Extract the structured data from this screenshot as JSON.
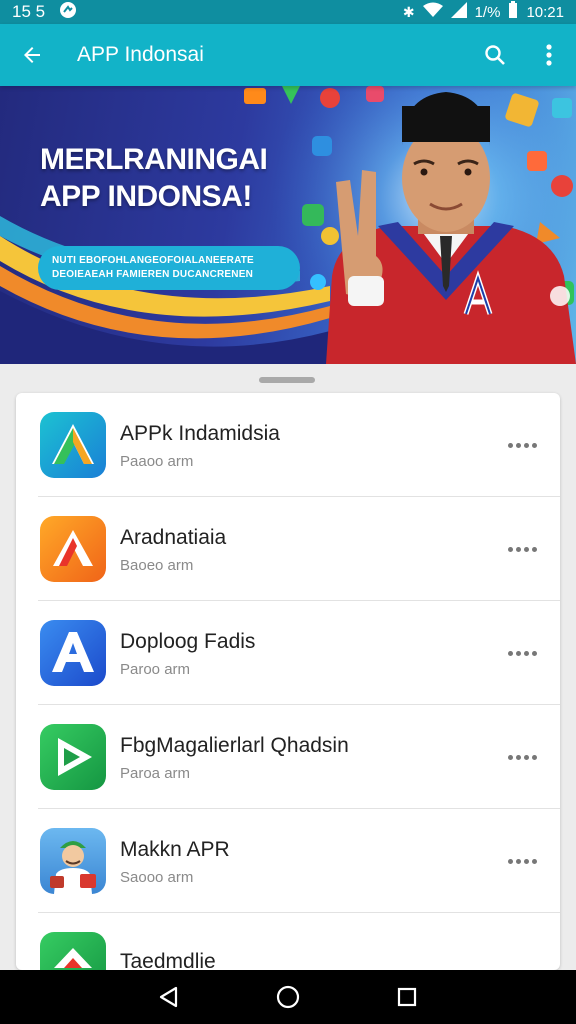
{
  "status_bar": {
    "time_left": "15 5",
    "battery_text": "1/%",
    "clock": "10:21",
    "icons": [
      "notification-badge-icon",
      "do-not-disturb-icon",
      "wifi-icon",
      "signal-icon",
      "battery-icon"
    ]
  },
  "app_bar": {
    "title": "APP Indonsai",
    "icons": [
      "back-arrow-icon",
      "search-icon",
      "overflow-menu-icon"
    ]
  },
  "banner": {
    "headline_line1": "MERLRANINGAI",
    "headline_line2": "APP INDONSA!",
    "tagline_line1": "NUTI EBOFOHLANGEOFOIALANEERATE",
    "tagline_line2": "DEOIEAEAH FAMIEREN DUCANCRENEN"
  },
  "apps": [
    {
      "name": "APPk Indamidsia",
      "subtitle": "Paaoo arm",
      "icon": "green-a-app-icon",
      "colors": [
        "#1cb5c9",
        "#1a86d6"
      ]
    },
    {
      "name": "Aradnatiaia",
      "subtitle": "Baoeo arm",
      "icon": "orange-a-app-icon",
      "colors": [
        "#ff9a1f",
        "#f06a18"
      ]
    },
    {
      "name": "Doploog Fadis",
      "subtitle": "Paroo arm",
      "icon": "blue-a-app-icon",
      "colors": [
        "#2f7be6",
        "#1d4fcf"
      ]
    },
    {
      "name": "FbgMagalierlarl Qhadsin",
      "subtitle": "Paroa arm",
      "icon": "green-play-app-icon",
      "colors": [
        "#2fc35a",
        "#169c45"
      ]
    },
    {
      "name": "Makkn APR",
      "subtitle": "Saooo arm",
      "icon": "character-app-icon",
      "colors": [
        "#5aa7e8",
        "#3b86d3"
      ]
    },
    {
      "name": "Taedmdlie",
      "subtitle": "",
      "icon": "green-house-app-icon",
      "colors": [
        "#2fc35a",
        "#169c45"
      ]
    }
  ],
  "nav_bar": {
    "icons": [
      "nav-back-icon",
      "nav-home-icon",
      "nav-recents-icon"
    ]
  }
}
